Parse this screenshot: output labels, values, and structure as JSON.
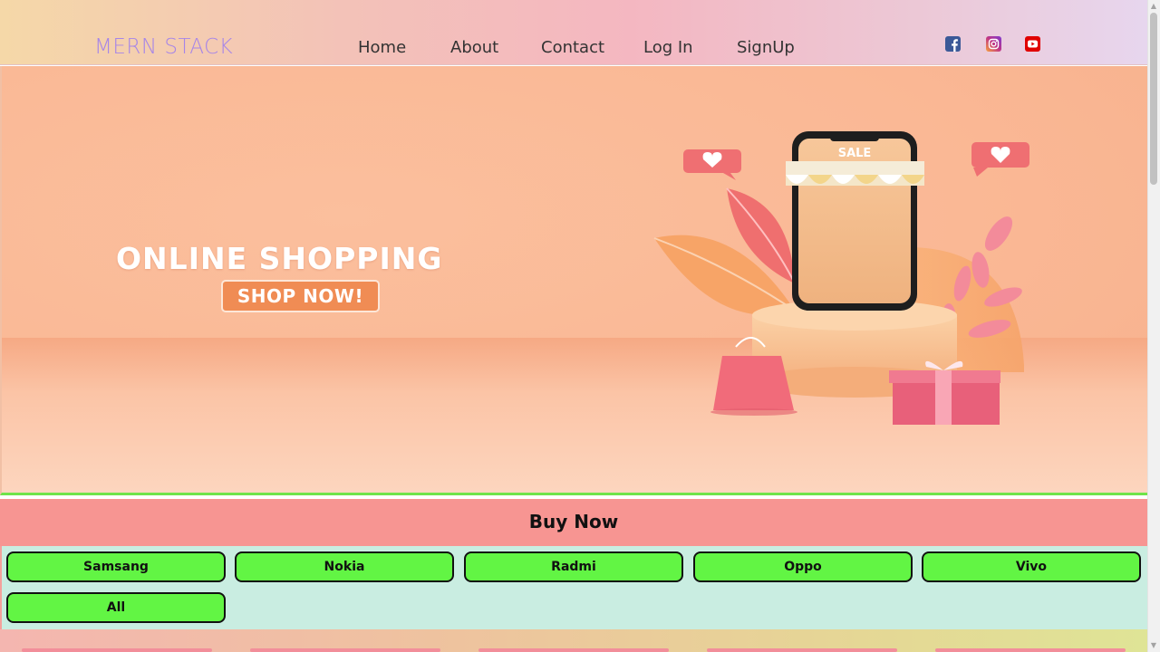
{
  "navbar": {
    "brand": "MERN STACK",
    "links": [
      "Home",
      "About",
      "Contact",
      "Log In",
      "SignUp"
    ],
    "social": [
      {
        "icon": "facebook-icon",
        "color": "#3b5998"
      },
      {
        "icon": "instagram-icon",
        "color": "#c13584"
      },
      {
        "icon": "youtube-icon",
        "color": "#e00000"
      }
    ]
  },
  "hero": {
    "title": "ONLINE SHOPPING",
    "cta": "SHOP NOW!",
    "sale_label": "SALE"
  },
  "buy_now": {
    "title": "Buy Now",
    "brands": [
      "Samsang",
      "Nokia",
      "Radmi",
      "Oppo",
      "Vivo",
      "All"
    ]
  },
  "colors": {
    "brand_text": "#a685e8",
    "button_green": "#62f544",
    "buy_now_bar": "#f79592",
    "brand_area_bg": "#c9ede1"
  }
}
